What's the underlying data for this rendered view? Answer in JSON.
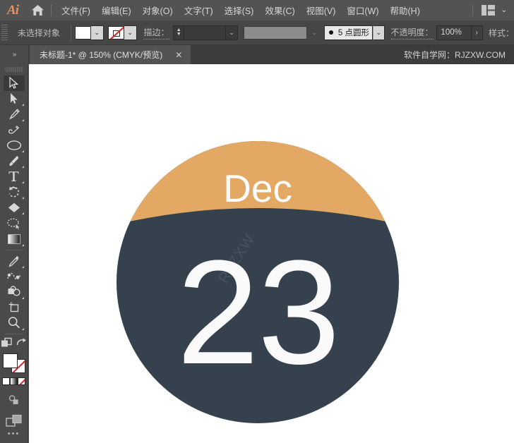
{
  "app": {
    "logo_text": "Ai",
    "home_icon": "home-icon"
  },
  "menubar": {
    "items": [
      {
        "label": "文件(F)",
        "name": "menu-file"
      },
      {
        "label": "编辑(E)",
        "name": "menu-edit"
      },
      {
        "label": "对象(O)",
        "name": "menu-object"
      },
      {
        "label": "文字(T)",
        "name": "menu-type"
      },
      {
        "label": "选择(S)",
        "name": "menu-select"
      },
      {
        "label": "效果(C)",
        "name": "menu-effect"
      },
      {
        "label": "视图(V)",
        "name": "menu-view"
      },
      {
        "label": "窗口(W)",
        "name": "menu-window"
      },
      {
        "label": "帮助(H)",
        "name": "menu-help"
      }
    ],
    "workspace_caret": "⌄"
  },
  "controlbar": {
    "selection_label": "未选择对象",
    "fill_swatch_color": "#ffffff",
    "stroke_swatch": "none",
    "fill_caret": "⌄",
    "stroke_caret": "⌄",
    "stroke_label": "描边：",
    "stroke_weight_value": "",
    "stroke_weight_caret": "⌄",
    "variable_width_value": "",
    "variable_width_caret": "⌄",
    "brush_dot": "●",
    "brush_profile": "5 点圆形",
    "brush_caret": "⌄",
    "opacity_label": "不透明度：",
    "opacity_value": "100%",
    "opacity_arrow": "›",
    "style_label": "样式："
  },
  "tabbar": {
    "gutter_icon": "double-chevron-right-icon",
    "gutter_glyph": "»",
    "document_title": "未标题-1* @ 150% (CMYK/预览)",
    "close_glyph": "✕",
    "watermark": "软件自学网：RJZXW.COM"
  },
  "toolbar": {
    "tools": [
      {
        "name": "tool-selection",
        "icon": "selection-arrow-icon",
        "active": true,
        "corner": false
      },
      {
        "name": "tool-direct-selection",
        "icon": "direct-selection-arrow-icon",
        "active": false,
        "corner": true
      },
      {
        "name": "tool-pen",
        "icon": "pen-icon",
        "active": false,
        "corner": true
      },
      {
        "name": "tool-curvature",
        "icon": "curvature-icon",
        "active": false,
        "corner": false
      },
      {
        "name": "tool-ellipse",
        "icon": "ellipse-icon",
        "active": false,
        "corner": true
      },
      {
        "name": "tool-paintbrush",
        "icon": "paintbrush-icon",
        "active": false,
        "corner": true
      },
      {
        "name": "tool-type",
        "icon": "type-t-icon",
        "active": false,
        "corner": true
      },
      {
        "name": "tool-rotate",
        "icon": "rotate-icon",
        "active": false,
        "corner": true
      },
      {
        "name": "tool-eraser",
        "icon": "eraser-icon",
        "active": false,
        "corner": true
      },
      {
        "name": "tool-lasso",
        "icon": "lasso-icon",
        "active": false,
        "corner": false
      },
      {
        "name": "tool-gradient",
        "icon": "gradient-icon",
        "active": false,
        "corner": true
      },
      {
        "name": "tool-eyedropper",
        "icon": "eyedropper-icon",
        "active": false,
        "corner": true
      },
      {
        "name": "tool-blend",
        "icon": "blend-icon",
        "active": false,
        "corner": false
      },
      {
        "name": "tool-shape-builder",
        "icon": "shape-builder-icon",
        "active": false,
        "corner": true
      },
      {
        "name": "tool-artboard",
        "icon": "artboard-icon",
        "active": false,
        "corner": false
      },
      {
        "name": "tool-zoom",
        "icon": "magnifier-icon",
        "active": false,
        "corner": true
      }
    ],
    "bottom": {
      "draw_modes_icon": "draw-modes-icon",
      "change_screen_icon": "change-screen-mode-icon",
      "fill_color": "#ffffff",
      "stroke_color": "none",
      "mini_color": "#ffffff",
      "mini_gradient": "gradient",
      "mini_none": "none",
      "edit_toolbar_glyph": "•••"
    }
  },
  "artwork": {
    "month": "Dec",
    "day": "23",
    "top_color": "#e3a863",
    "body_color": "#35424e",
    "text_color": "#ffffff",
    "watermark": "RJZXW"
  }
}
